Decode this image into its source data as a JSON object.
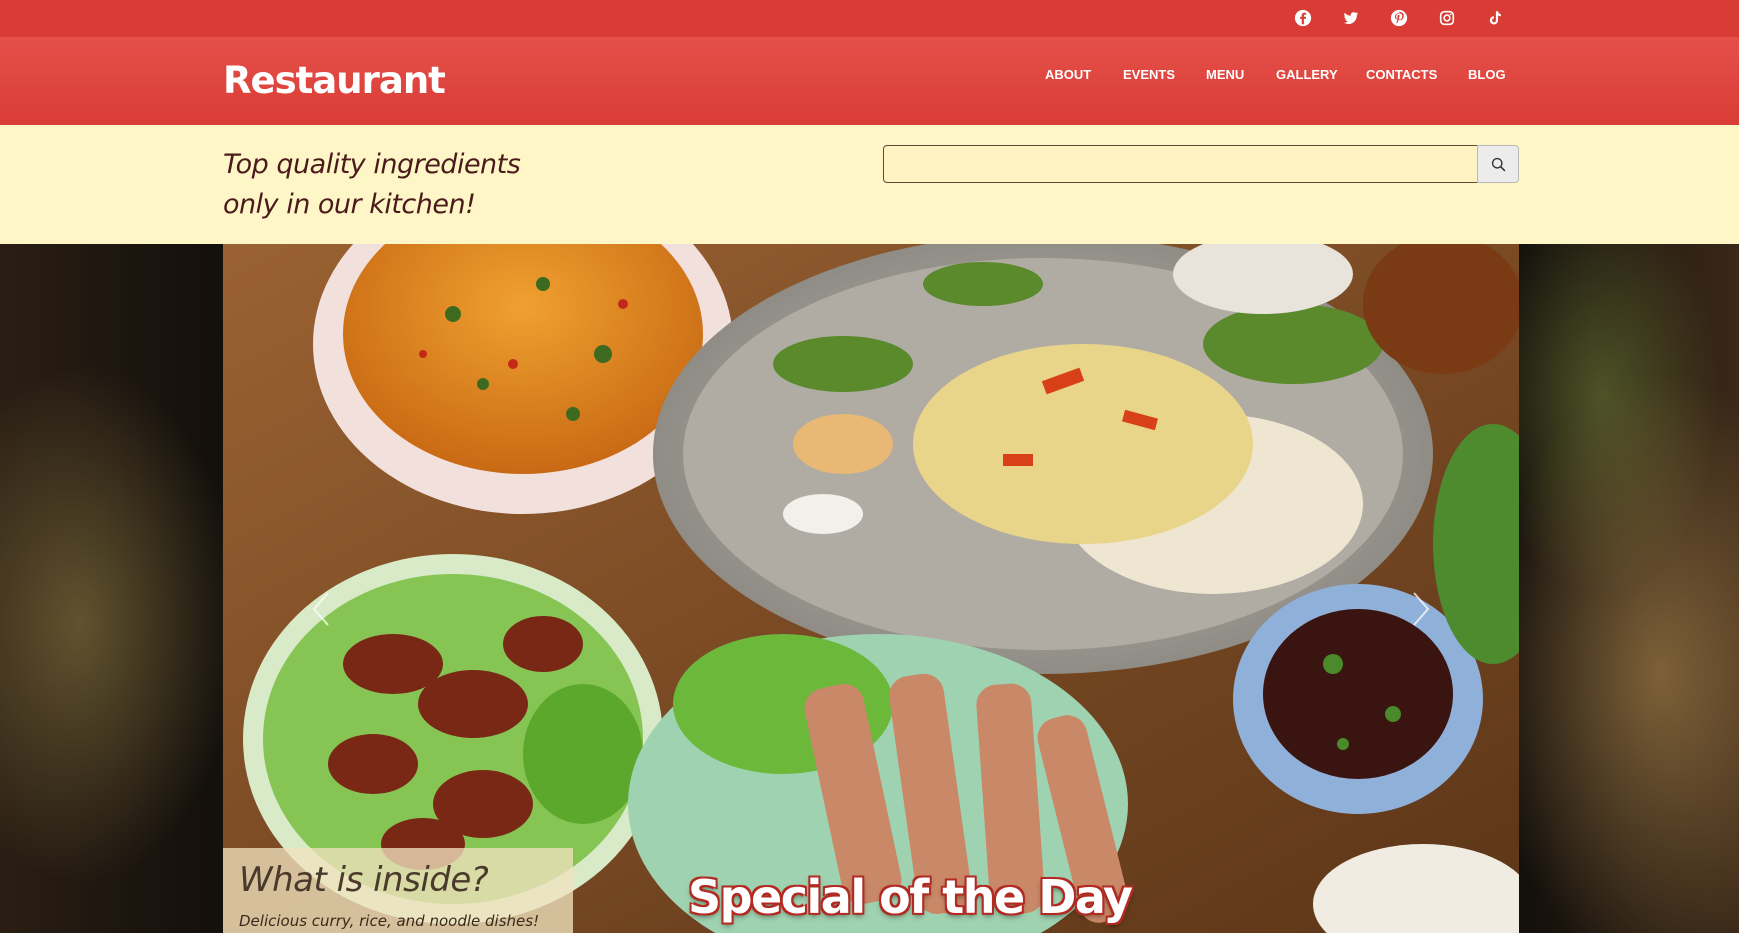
{
  "social": {
    "icons": [
      "facebook-icon",
      "twitter-icon",
      "pinterest-icon",
      "instagram-icon",
      "tiktok-icon"
    ]
  },
  "header": {
    "brand": "Restaurant",
    "nav": [
      "ABOUT",
      "EVENTS",
      "MENU",
      "GALLERY",
      "CONTACTS",
      "BLOG"
    ]
  },
  "tagline": {
    "line1": "Top quality ingredients",
    "line2": "only in our kitchen!"
  },
  "search": {
    "value": "",
    "button_icon": "search-icon"
  },
  "hero": {
    "caption_title": "What is inside?",
    "caption_subtitle": "Delicious curry, rice, and noodle dishes!",
    "special": "Special of the Day",
    "prev_icon": "chevron-left-icon",
    "next_icon": "chevron-right-icon"
  },
  "colors": {
    "brand_red": "#d93c34",
    "tagline_bg": "#fff6c8",
    "tagline_text": "#4b1b1b"
  }
}
